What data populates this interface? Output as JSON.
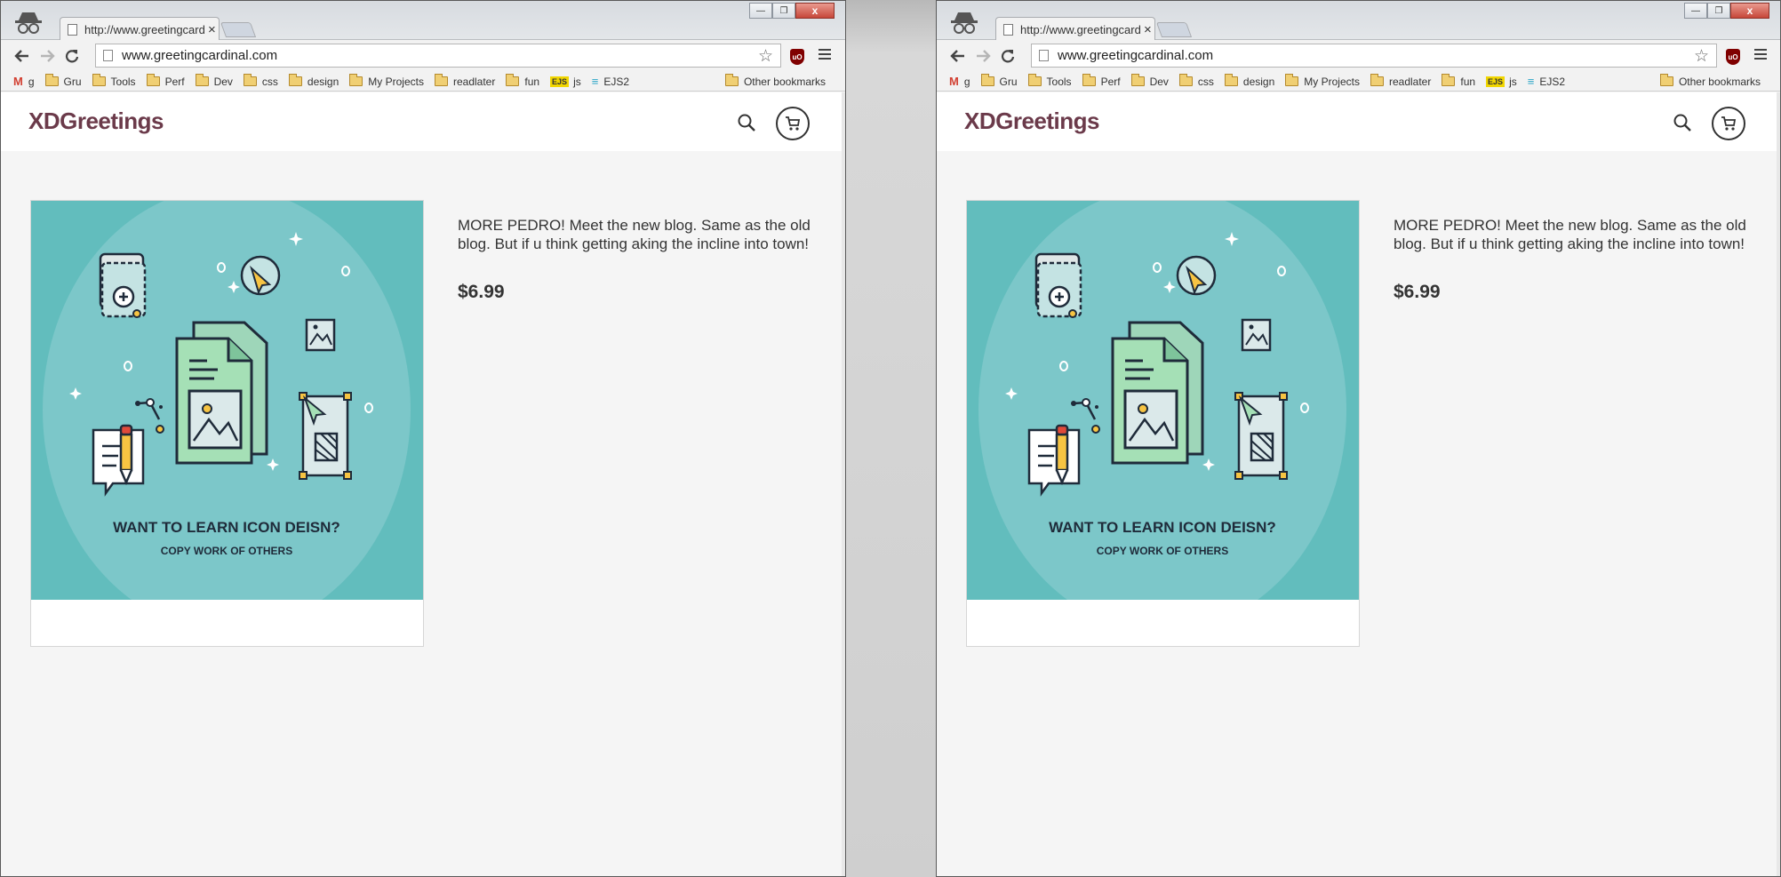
{
  "browser": {
    "tab_title": "http://www.greetingcardir",
    "tab_close": "×",
    "url": "www.greetingcardinal.com",
    "window_controls": {
      "minimize": "—",
      "restore": "❐",
      "close": "x"
    },
    "extension": "uO",
    "bookmarks": [
      {
        "label": "g",
        "icon": "gmail-icon"
      },
      {
        "label": "Gru",
        "icon": "folder-icon"
      },
      {
        "label": "Tools",
        "icon": "folder-icon"
      },
      {
        "label": "Perf",
        "icon": "folder-icon"
      },
      {
        "label": "Dev",
        "icon": "folder-icon"
      },
      {
        "label": "css",
        "icon": "folder-icon"
      },
      {
        "label": "design",
        "icon": "folder-icon"
      },
      {
        "label": "My Projects",
        "icon": "folder-icon"
      },
      {
        "label": "readlater",
        "icon": "folder-icon"
      },
      {
        "label": "fun",
        "icon": "folder-icon"
      },
      {
        "label": "js",
        "icon": "ejs-icon"
      },
      {
        "label": "EJS2",
        "icon": "ejs2-icon"
      }
    ],
    "ejs_badge": "EJS",
    "other_bookmarks": "Other bookmarks"
  },
  "site": {
    "logo": "XDGreetings",
    "product": {
      "image_heading": "WANT TO LEARN ICON DEISN?",
      "image_subheading": "COPY WORK OF OTHERS",
      "description": "MORE PEDRO! Meet the new blog. Same as the old blog. But if u think getting aking the incline into town!",
      "price": "$6.99"
    }
  },
  "colors": {
    "logo": "#6b3a4a",
    "image_bg": "#62bdbd",
    "image_circle": "#7cc7c9",
    "page_bg": "#f5f5f5"
  }
}
